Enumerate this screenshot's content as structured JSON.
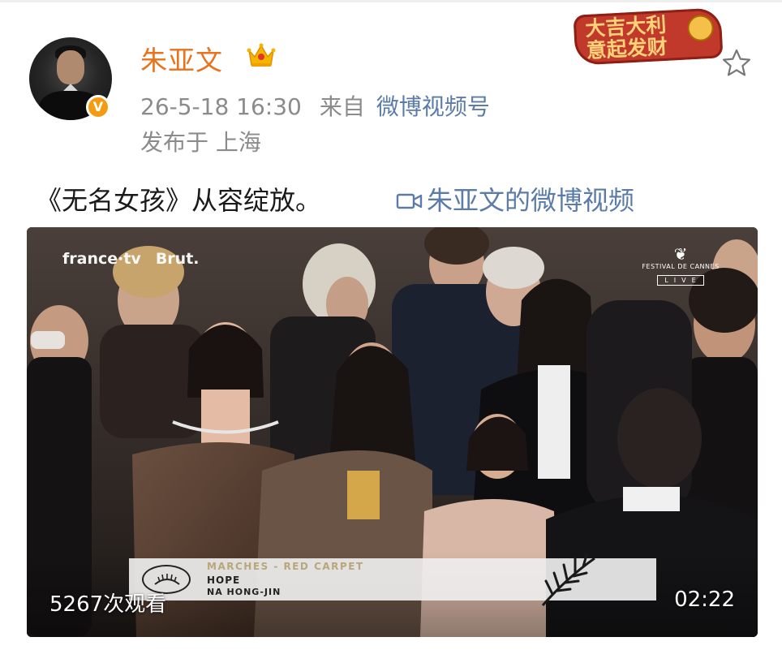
{
  "post": {
    "author": {
      "name": "朱亚文",
      "verified_icon": "verified-v-icon",
      "badge_icon": "crown-icon"
    },
    "timestamp": "26-5-18 16:30",
    "from_label": "来自",
    "source": "微博视频号",
    "location": "发布于 上海",
    "sticker_text": "大吉大利意起发财",
    "text": "《无名女孩》从容绽放。",
    "video_link_label": "朱亚文的微博视频",
    "video": {
      "watermark_left": "france·tv",
      "watermark_brand": "Brut.",
      "festival_name": "FESTIVAL DE CANNES",
      "live_label": "LIVE",
      "lower_third": {
        "tag": "MARCHES - RED CARPET",
        "title": "HOPE",
        "director": "NA HONG-JIN"
      },
      "views": "5267次观看",
      "duration": "02:22"
    }
  },
  "colors": {
    "author_name": "#e8731c",
    "link": "#5b7ba8",
    "meta_text": "#8b8b8b",
    "body_text": "#1a1a1a"
  }
}
